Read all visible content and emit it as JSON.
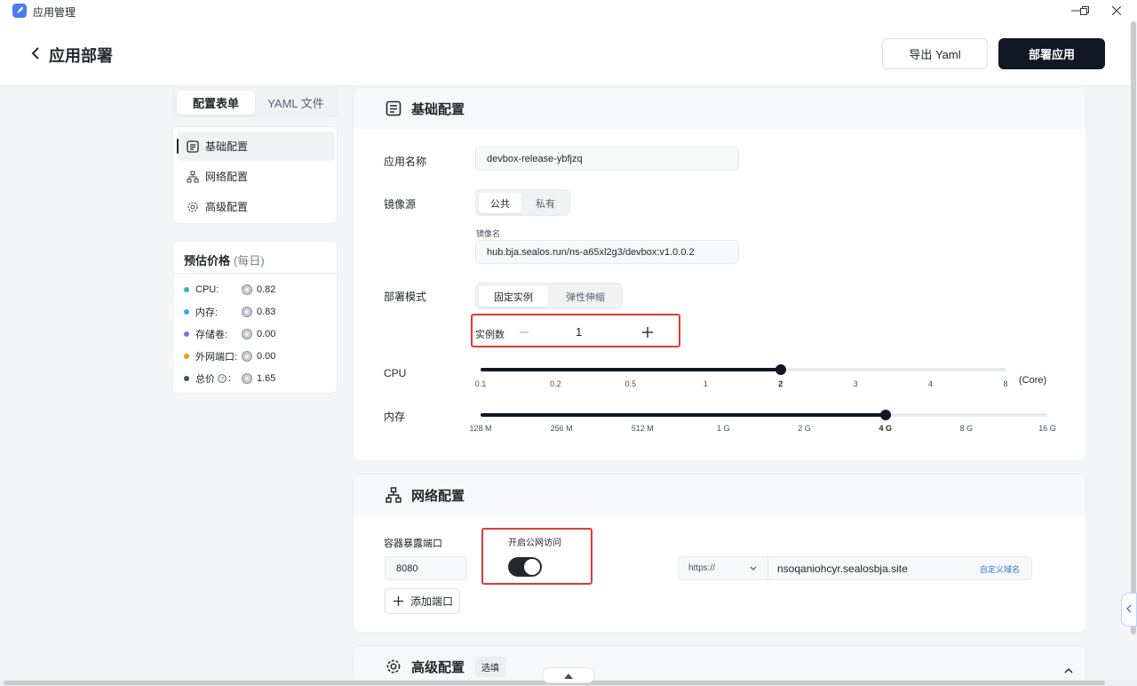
{
  "titlebar": {
    "app_title": "应用管理"
  },
  "header": {
    "title": "应用部署",
    "export_label": "导出 Yaml",
    "deploy_label": "部署应用"
  },
  "left_tabs": [
    "配置表单",
    "YAML 文件"
  ],
  "left_nav": [
    {
      "label": "基础配置",
      "icon": "list-icon"
    },
    {
      "label": "网络配置",
      "icon": "network-icon"
    },
    {
      "label": "高级配置",
      "icon": "gear-icon"
    }
  ],
  "price": {
    "title": "预估价格",
    "subtitle": "(每日)",
    "rows": [
      {
        "label": "CPU:",
        "value": "0.82",
        "color": "#30b9b5"
      },
      {
        "label": "内存:",
        "value": "0.83",
        "color": "#36a7f2"
      },
      {
        "label": "存储卷:",
        "value": "0.00",
        "color": "#8172d8"
      },
      {
        "label": "外网端口:",
        "value": "0.00",
        "color": "#f39c12"
      },
      {
        "label": "总价",
        "value": "1.65",
        "color": "#485058"
      }
    ]
  },
  "basic": {
    "title": "基础配置",
    "app_name_label": "应用名称",
    "app_name_value": "devbox-release-ybfjzq",
    "image_source_label": "镜像源",
    "image_source_options": [
      "公共",
      "私有"
    ],
    "image_name_label": "镜像名",
    "image_name_value": "hub.bja.sealos.run/ns-a65xl2g3/devbox:v1.0.0.2",
    "deploy_mode_label": "部署模式",
    "deploy_mode_options": [
      "固定实例",
      "弹性伸缩"
    ],
    "instances_label": "实例数",
    "instances_value": "1",
    "cpu_label": "CPU",
    "cpu_ticks": [
      "0.1",
      "0.2",
      "0.5",
      "1",
      "2",
      "3",
      "4",
      "8"
    ],
    "cpu_selected": "2",
    "cpu_unit": "(Core)",
    "mem_label": "内存",
    "mem_ticks": [
      "128 M",
      "256 M",
      "512 M",
      "1 G",
      "2 G",
      "4 G",
      "8 G",
      "16 G"
    ],
    "mem_selected": "4 G"
  },
  "network": {
    "title": "网络配置",
    "port_label": "容器暴露端口",
    "port_value": "8080",
    "public_label": "开启公网访问",
    "public_enabled": true,
    "protocol": "https://",
    "domain": "nsoqaniohcyr.sealosbja.site",
    "custom_domain_label": "自定义域名",
    "add_port_label": "添加端口"
  },
  "advanced": {
    "title": "高级配置",
    "badge": "选填"
  }
}
